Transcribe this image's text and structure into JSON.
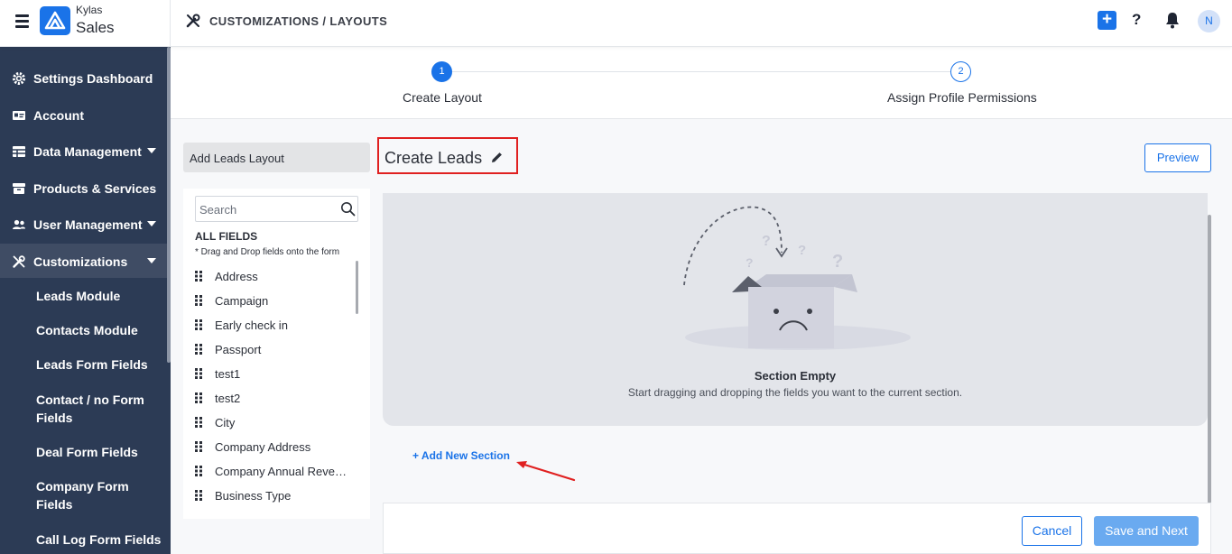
{
  "app": {
    "brand_top": "Kylas",
    "brand_main": "Sales"
  },
  "header": {
    "breadcrumb": "CUSTOMIZATIONS / LAYOUTS",
    "help_label": "?",
    "avatar_initial": "N",
    "add_label": "+"
  },
  "sidebar": {
    "items": [
      {
        "label": "Settings Dashboard",
        "icon": "gear-icon"
      },
      {
        "label": "Account",
        "icon": "id-card-icon"
      },
      {
        "label": "Data Management",
        "icon": "table-icon",
        "has_caret": true
      },
      {
        "label": "Products & Services",
        "icon": "box-icon"
      },
      {
        "label": "User Management",
        "icon": "users-icon",
        "has_caret": true
      },
      {
        "label": "Customizations",
        "icon": "tools-icon",
        "has_caret": true,
        "active": true
      }
    ],
    "sub_items": [
      "Leads Module",
      "Contacts Module",
      "Leads Form Fields",
      "Contact / no Form Fields",
      "Deal Form Fields",
      "Company Form Fields",
      "Call Log Form Fields"
    ]
  },
  "stepper": {
    "steps": [
      {
        "number": "1",
        "label": "Create Layout",
        "state": "active"
      },
      {
        "number": "2",
        "label": "Assign Profile Permissions",
        "state": "pending"
      }
    ]
  },
  "layout": {
    "name": "Add Leads Layout"
  },
  "fields_panel": {
    "search_placeholder": "Search",
    "heading": "ALL FIELDS",
    "hint": "* Drag and Drop fields onto the form",
    "fields": [
      "Address",
      "Campaign",
      "Early check in",
      "Passport",
      "test1",
      "test2",
      "City",
      "Company Address",
      "Company Annual Revenue",
      "Business Type"
    ]
  },
  "form": {
    "title": "Create Leads",
    "preview_label": "Preview",
    "section_empty_title": "Section Empty",
    "section_empty_sub": "Start dragging and dropping the fields you want to the current section.",
    "add_section_label": "+ Add New Section"
  },
  "footer": {
    "cancel_label": "Cancel",
    "save_label": "Save and Next"
  },
  "colors": {
    "accent": "#1a73e8",
    "sidebar": "#2c3b55",
    "highlight_border": "#e02020"
  }
}
